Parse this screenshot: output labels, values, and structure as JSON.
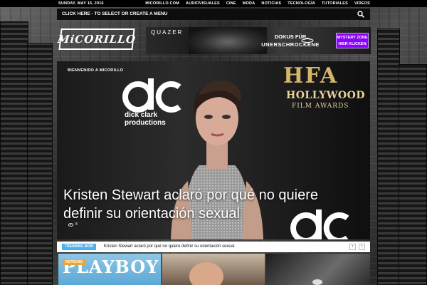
{
  "topbar": {
    "date": "SUNDAY, MAY 15, 2016",
    "links": [
      "MICORILLO.COM",
      "AUDIOVISUALES",
      "CINE",
      "MODA",
      "NOTICIAS",
      "TECNOLOGÍA",
      "TUTORIALES",
      "VIDEOS"
    ]
  },
  "menubar": {
    "menu_text": "CLICK HERE - TO SELECT OR CREATE A MENU",
    "search_icon": "search-icon"
  },
  "logo": {
    "text": "MiCORILLO"
  },
  "ad": {
    "brand": "QUAZER",
    "line1": "DOKUS FÜR",
    "line2": "UNERSCHROCKENE",
    "cta_line1": "MYSTERY ZONE",
    "cta_line2": "HIER KLICKEN",
    "cta_color": "#8b00ff"
  },
  "hero": {
    "kicker": "BIENVENIDO A MICORILLO",
    "headline": "Kristen Stewart aclaró por qué no quiere definir su orientación sexual",
    "views": "8",
    "backdrop_dc_line1": "dick clark",
    "backdrop_dc_line2": "productions",
    "backdrop_hfa": "HFA",
    "backdrop_hollywood": "HOLLYWOOD",
    "backdrop_film_awards": "FILM AWARDS"
  },
  "trending": {
    "label": "TRENDING NOW",
    "item": "Kristen Stewart aclaró por qué no quiere definir su orientación sexual",
    "prev": "‹",
    "next": "›",
    "accent": "#4db2ec"
  },
  "tiles": [
    {
      "category": "NOTICIAS",
      "image_text": "PLAYBOY"
    },
    {
      "category": "",
      "image_text": ""
    },
    {
      "category": "",
      "image_text": ""
    }
  ]
}
